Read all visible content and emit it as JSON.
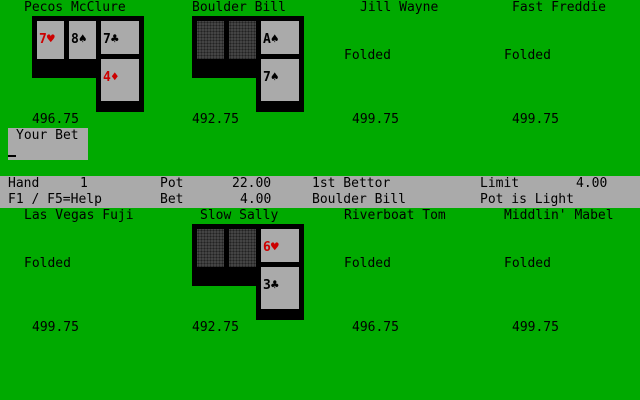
{
  "players_top": [
    {
      "name": "Pecos McClure",
      "status": "",
      "money": "496.75"
    },
    {
      "name": "Boulder Bill",
      "status": "",
      "money": "492.75"
    },
    {
      "name": "Jill Wayne",
      "status": "Folded",
      "money": "499.75"
    },
    {
      "name": "Fast Freddie",
      "status": "Folded",
      "money": "499.75"
    }
  ],
  "players_bottom": [
    {
      "name": "Las Vegas Fuji",
      "status": "Folded",
      "money": "499.75"
    },
    {
      "name": "Slow Sally",
      "status": "",
      "money": "492.75"
    },
    {
      "name": "Riverboat Tom",
      "status": "Folded",
      "money": "496.75"
    },
    {
      "name": "Middlin' Mabel",
      "status": "Folded",
      "money": "499.75"
    }
  ],
  "cards": {
    "pecos_1": "7♥",
    "pecos_2": "8♠",
    "pecos_3": "7♣",
    "pecos_4": "4♦",
    "bill_3": "A♠",
    "bill_4": "7♠",
    "sally_3": "6♥",
    "sally_4": "3♣"
  },
  "bet_prompt": "Your Bet",
  "status": {
    "hand_label": "Hand",
    "hand_value": "1",
    "pot_label": "Pot",
    "pot_value": "22.00",
    "first_bettor_label": "1st Bettor",
    "first_bettor_value": "Boulder Bill",
    "limit_label": "Limit",
    "limit_value": "4.00",
    "help": "F1 / F5=Help",
    "bet_label": "Bet",
    "bet_value": "4.00",
    "pot_light": "Pot is Light"
  },
  "colors": {
    "table": "#00aa00",
    "panel": "#aaaaaa",
    "red_suit": "#cc0000"
  }
}
